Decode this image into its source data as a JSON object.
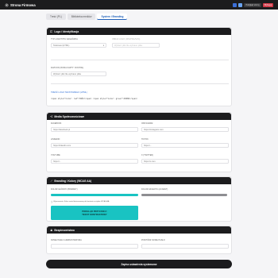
{
  "topbar": {
    "title": "Strona Firmowa",
    "view_label": "Podgląd strony",
    "logout_label": "Wyloguj"
  },
  "tabs": [
    {
      "label": "Treść (PL)"
    },
    {
      "label": "Biblioteka mediów"
    },
    {
      "label": "System i Branding"
    }
  ],
  "logo_section": {
    "header": "Logo i Identyfikacja",
    "type_label": "TYP LOGOTYPU NAGŁÓWKA",
    "type_value": "Tekstowe (HTML)",
    "image_label": "OBRAZ LOGO (JPG/PNG/SVG)",
    "image_placeholder": "Wybierz plik    Nie wybrano pliku",
    "favicon_label": "FAVICON (IKONA KARTY: ICO/PNG)",
    "favicon_value": "Wybierz plik    Nie wybrano pliku",
    "text_label": "TREŚĆ LOGO TEKSTOWEGO (HTML)",
    "text_value": "<span style=\"color: red\">TWÓJ</span> <span style=\"color: green\">FIRMA</span>"
  },
  "social_section": {
    "header": "Media Społecznościowe",
    "fields": [
      {
        "label": "FACEBOOK",
        "value": "https://facebook.pl"
      },
      {
        "label": "INSTAGRAM",
        "value": "https://instagram.com"
      },
      {
        "label": "LINKEDIN",
        "value": "https://linkedin.com"
      },
      {
        "label": "TIKTOK",
        "value": "https://..."
      },
      {
        "label": "YOUTUBE",
        "value": "https://..."
      },
      {
        "label": "X (TWITTER)",
        "value": "https://x.com"
      }
    ]
  },
  "branding_section": {
    "header": "Branding i Kolory (WCAG AA)",
    "primary_label": "KOLOR GŁÓWNY (PRIMARY)",
    "secondary_label": "KOLOR AKCENTU (ACCENT)",
    "contrast_note": "Wymuszenie: Kolor został dostosowany do kontrastu w trybie WCAG AA",
    "preview_line1": "PODGLĄD PRZYCISKU:",
    "preview_line2": "TEKST KONTRASTOWY",
    "primary_color": "#19c3c2",
    "secondary_color": "#8e8e92"
  },
  "security_section": {
    "header": "Bezpieczeństwo",
    "new_password_label": "NOWE HASŁO ADMINISTRATORA",
    "repeat_password_label": "POWTÓRZ NOWE HASŁO"
  },
  "save_label": "Zapisz ustawienia systemowe"
}
